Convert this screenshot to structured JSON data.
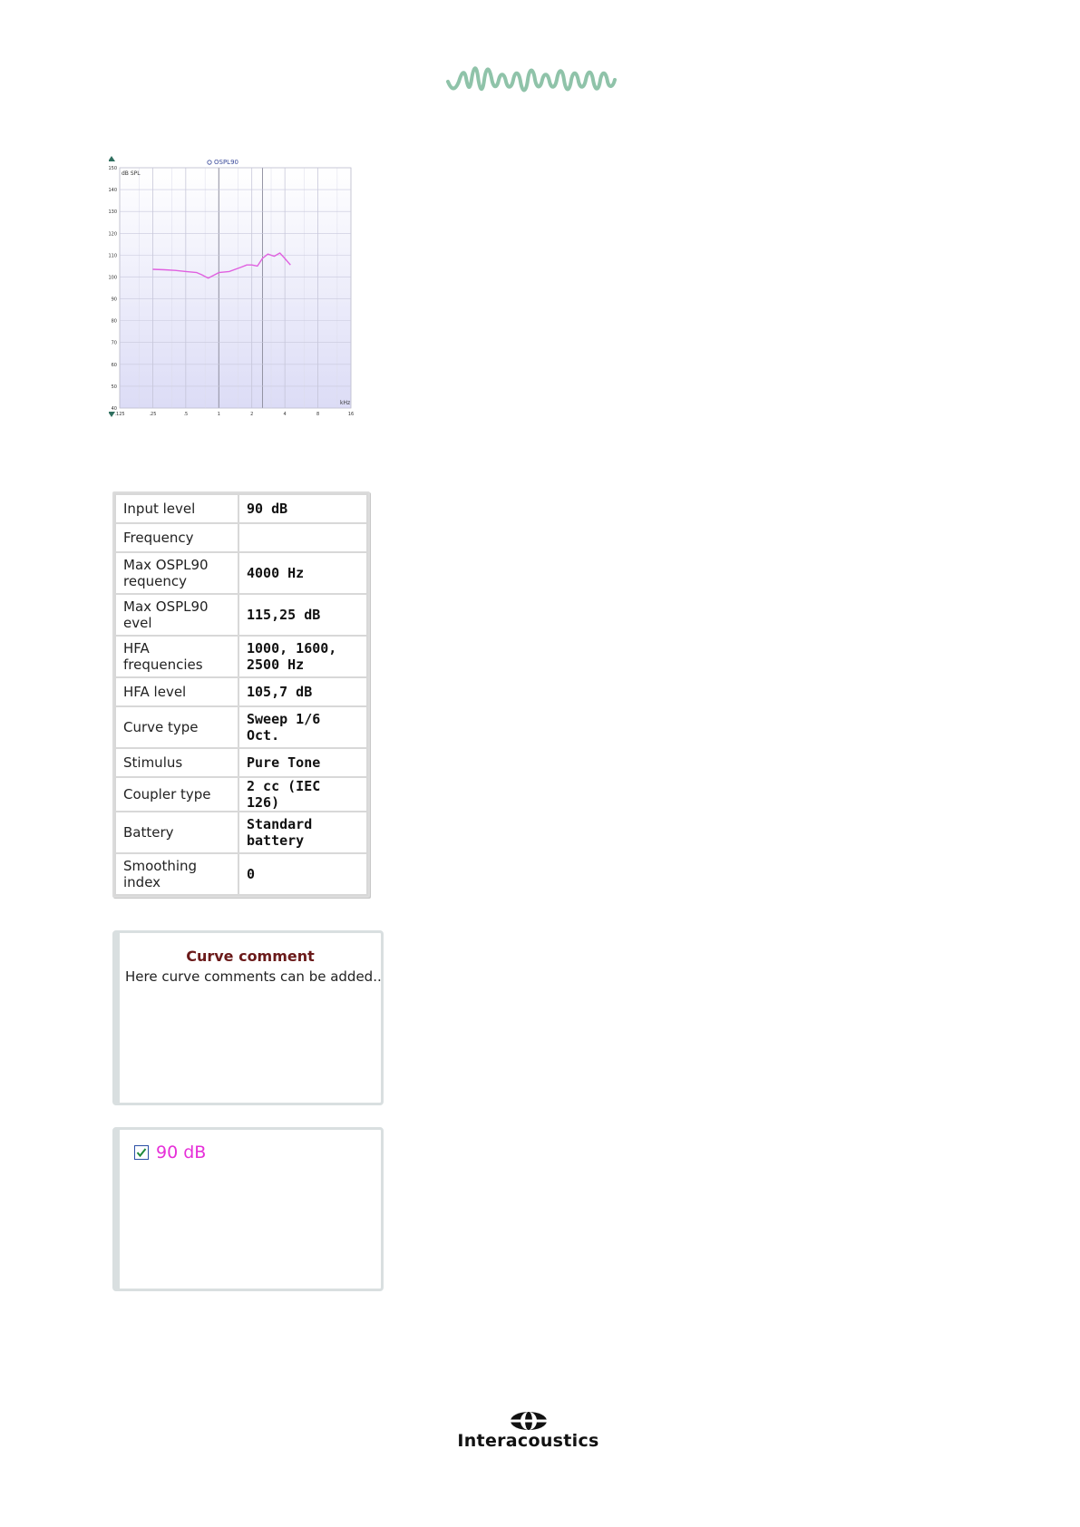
{
  "header": {
    "logo_icon": "waveform-logo-icon",
    "logo_color": "#8fc3a9"
  },
  "graph": {
    "legend_title": "OSPL90",
    "y_unit": "dB SPL",
    "x_unit": "kHz",
    "curve_color": "#e060e0",
    "y_ticks": [
      "150",
      "140",
      "130",
      "120",
      "110",
      "100",
      "90",
      "80",
      "70",
      "60",
      "50",
      "40"
    ],
    "x_ticks": [
      ".125",
      ".25",
      ".5",
      "1",
      "2",
      "4",
      "8",
      "16"
    ]
  },
  "chart_data": {
    "type": "line",
    "title": "OSPL90",
    "ylabel": "dB SPL",
    "xlabel": "kHz",
    "xscale": "log",
    "ylim": [
      40,
      150
    ],
    "xlim": [
      0.125,
      16
    ],
    "grid": true,
    "series": [
      {
        "name": "90 dB",
        "x": [
          0.25,
          0.32,
          0.4,
          0.5,
          0.63,
          0.7,
          0.8,
          1.0,
          1.25,
          1.6,
          1.8,
          2.0,
          2.25,
          2.5,
          2.8,
          3.2,
          3.6,
          4.0,
          4.5
        ],
        "y": [
          103.5,
          103.3,
          103.0,
          102.5,
          102.0,
          101.0,
          99.5,
          102.0,
          102.5,
          104.5,
          105.5,
          105.5,
          105.0,
          108.5,
          110.5,
          109.5,
          111.0,
          108.5,
          105.5
        ]
      }
    ]
  },
  "info": {
    "rows": [
      {
        "label": "Input level",
        "value": "90 dB"
      },
      {
        "label": "Frequency",
        "value": ""
      },
      {
        "label": "Max OSPL90 requency",
        "value": "4000 Hz"
      },
      {
        "label": "Max OSPL90 evel",
        "value": "115,25 dB"
      },
      {
        "label": "HFA frequencies",
        "value": "1000, 1600, 2500 Hz"
      },
      {
        "label": "HFA level",
        "value": "105,7 dB"
      },
      {
        "label": "Curve type",
        "value": "Sweep 1/6 Oct."
      },
      {
        "label": "Stimulus",
        "value": "Pure Tone"
      },
      {
        "label": "Coupler type",
        "value": "2 cc (IEC 126)"
      },
      {
        "label": "Battery",
        "value": "Standard battery"
      },
      {
        "label": "Smoothing index",
        "value": "0"
      }
    ]
  },
  "comment": {
    "title": "Curve comment",
    "text": "Here curve comments can be added..."
  },
  "legend": {
    "label": "90 dB",
    "checked": true,
    "color": "#e62fd8"
  },
  "brand": {
    "name": "Interacoustics",
    "icon": "interacoustics-logo-icon"
  }
}
